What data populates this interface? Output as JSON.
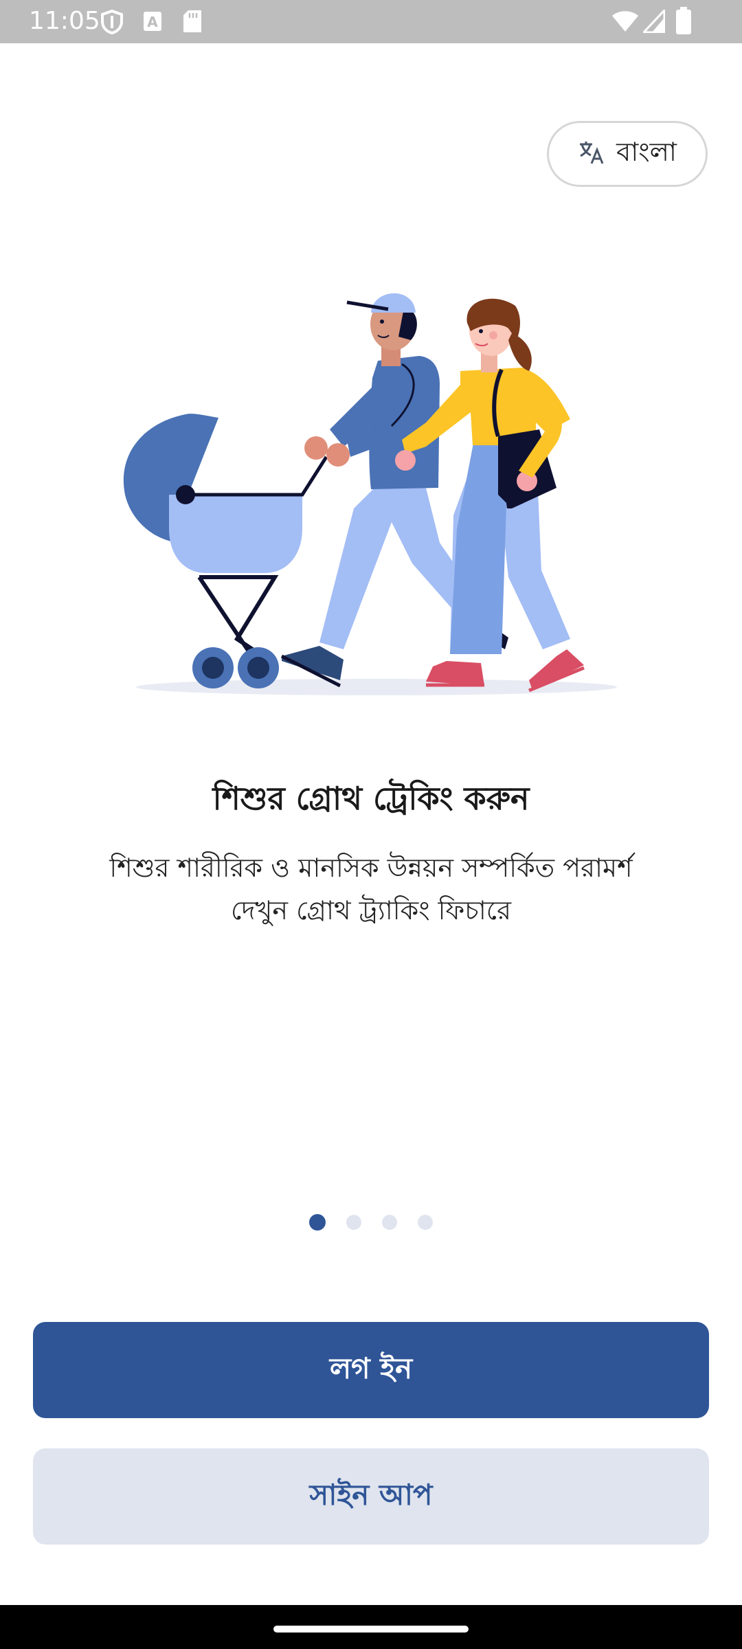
{
  "status_bar": {
    "time": "11:05",
    "left_icons": [
      "shield-icon",
      "font-a-icon",
      "sd-card-icon"
    ],
    "right_icons": [
      "wifi-icon",
      "signal-icon",
      "battery-icon"
    ]
  },
  "language_button": {
    "icon": "translate-icon",
    "label": "বাংলা"
  },
  "onboarding": {
    "illustration": "parents-with-stroller-illustration",
    "title": "শিশুর গ্রোথ ট্রেকিং করুন",
    "description_line1": "শিশুর শারীরিক ও মানসিক উন্নয়ন সম্পর্কিত পরামর্শ",
    "description_line2": "দেখুন গ্রোথ ট্র্যাকিং ফিচারে",
    "page_count": 4,
    "current_page": 1
  },
  "actions": {
    "login_label": "লগ ইন",
    "signup_label": "সাইন আপ"
  },
  "colors": {
    "primary": "#2f5597",
    "secondary_bg": "#dfe4ee",
    "status_bar": "#bdbdbd"
  }
}
